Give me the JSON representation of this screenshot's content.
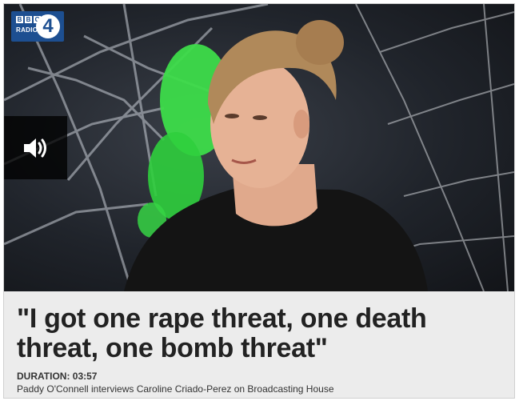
{
  "brand": {
    "network_letters": [
      "B",
      "B",
      "C"
    ],
    "station_word": "RADIO",
    "station_number": "4",
    "brand_color": "#1d4f91"
  },
  "player": {
    "control_icon": "speaker-volume-icon",
    "overlay_color": "#000000"
  },
  "clip": {
    "headline": "\"I got one rape threat, one death threat, one bomb threat\"",
    "duration_label": "DURATION:",
    "duration_value": "03:57",
    "summary": "Paddy O'Connell interviews Caroline Criado-Perez on Broadcasting House"
  },
  "colors": {
    "caption_background": "#ececec",
    "headline_text": "#222222",
    "accent_green": "#3ddc4a"
  }
}
